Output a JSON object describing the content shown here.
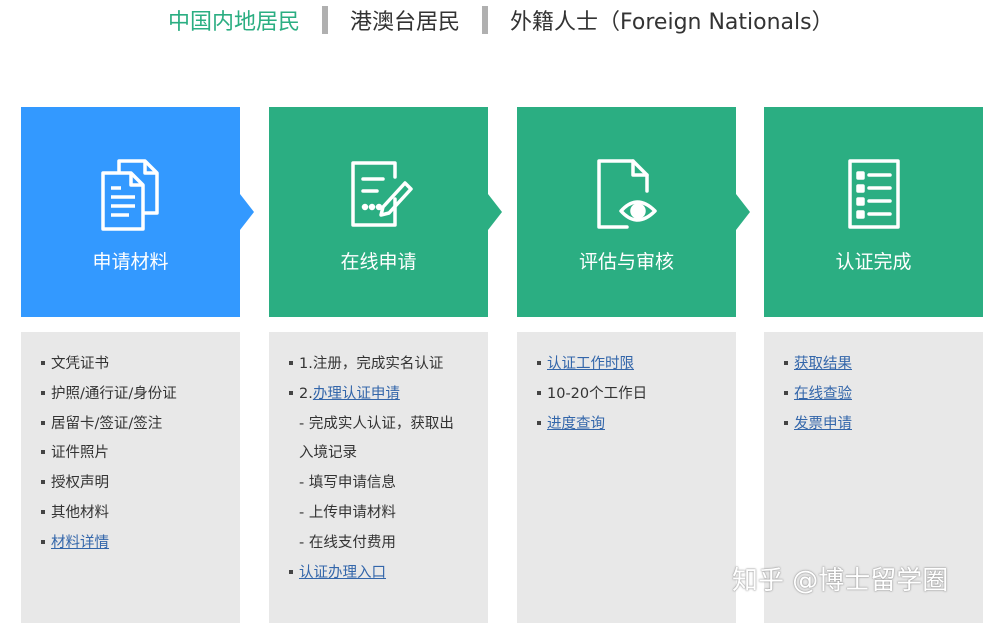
{
  "tabs": [
    {
      "label": "中国内地居民",
      "active": true
    },
    {
      "label": "港澳台居民",
      "active": false
    },
    {
      "label": "外籍人士（Foreign Nationals）",
      "active": false
    }
  ],
  "colors": {
    "blue": "#3399ff",
    "green": "#2bae82",
    "panel": "#e8e8e8",
    "link": "#3366aa"
  },
  "steps": [
    {
      "label": "申请材料",
      "icon": "documents-icon"
    },
    {
      "label": "在线申请",
      "icon": "form-edit-icon"
    },
    {
      "label": "评估与审核",
      "icon": "document-eye-icon"
    },
    {
      "label": "认证完成",
      "icon": "checklist-icon"
    }
  ],
  "panels": [
    {
      "items": [
        {
          "text": "文凭证书"
        },
        {
          "text": "护照/通行证/身份证"
        },
        {
          "text": "居留卡/签证/签注"
        },
        {
          "text": "证件照片"
        },
        {
          "text": "授权声明"
        },
        {
          "text": "其他材料"
        },
        {
          "link": "材料详情"
        }
      ]
    },
    {
      "items": [
        {
          "text": "1.注册，完成实名认证"
        },
        {
          "prefix": "2.",
          "link": "办理认证申请"
        },
        {
          "sub": "- 完成实人认证，获取出"
        },
        {
          "sub": "入境记录"
        },
        {
          "sub": "- 填写申请信息"
        },
        {
          "sub": "- 上传申请材料"
        },
        {
          "sub": "- 在线支付费用"
        },
        {
          "link": "认证办理入口"
        }
      ]
    },
    {
      "items": [
        {
          "link": "认证工作时限"
        },
        {
          "text": "10-20个工作日"
        },
        {
          "link": "进度查询"
        }
      ]
    },
    {
      "items": [
        {
          "link": "获取结果"
        },
        {
          "link": "在线查验"
        },
        {
          "link": "发票申请"
        }
      ]
    }
  ],
  "watermark": "知乎 @博士留学圈"
}
